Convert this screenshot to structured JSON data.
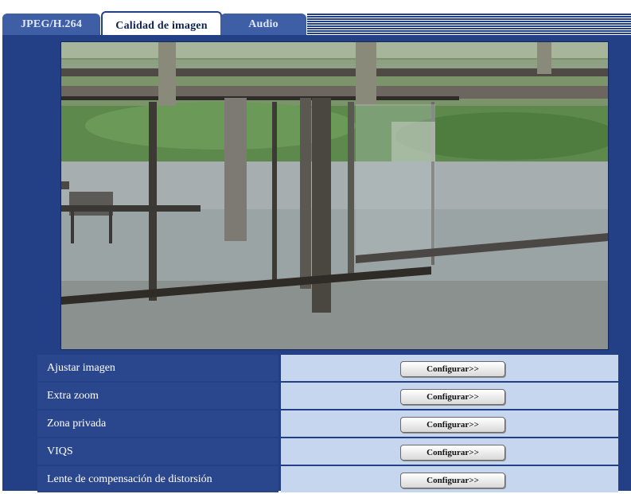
{
  "tabs": [
    {
      "label": "JPEG/H.264",
      "active": false
    },
    {
      "label": "Calidad de imagen",
      "active": true
    },
    {
      "label": "Audio",
      "active": false
    }
  ],
  "settings_rows": [
    {
      "label": "Ajustar imagen",
      "button": "Configurar>>"
    },
    {
      "label": "Extra zoom",
      "button": "Configurar>>"
    },
    {
      "label": "Zona privada",
      "button": "Configurar>>"
    },
    {
      "label": "VIQS",
      "button": "Configurar>>"
    },
    {
      "label": "Lente de compensación de distorsión",
      "button": "Configurar>>"
    }
  ],
  "colors": {
    "panel": "#233f86",
    "cell": "#c6d6ee",
    "tab": "#3e5fa6"
  }
}
